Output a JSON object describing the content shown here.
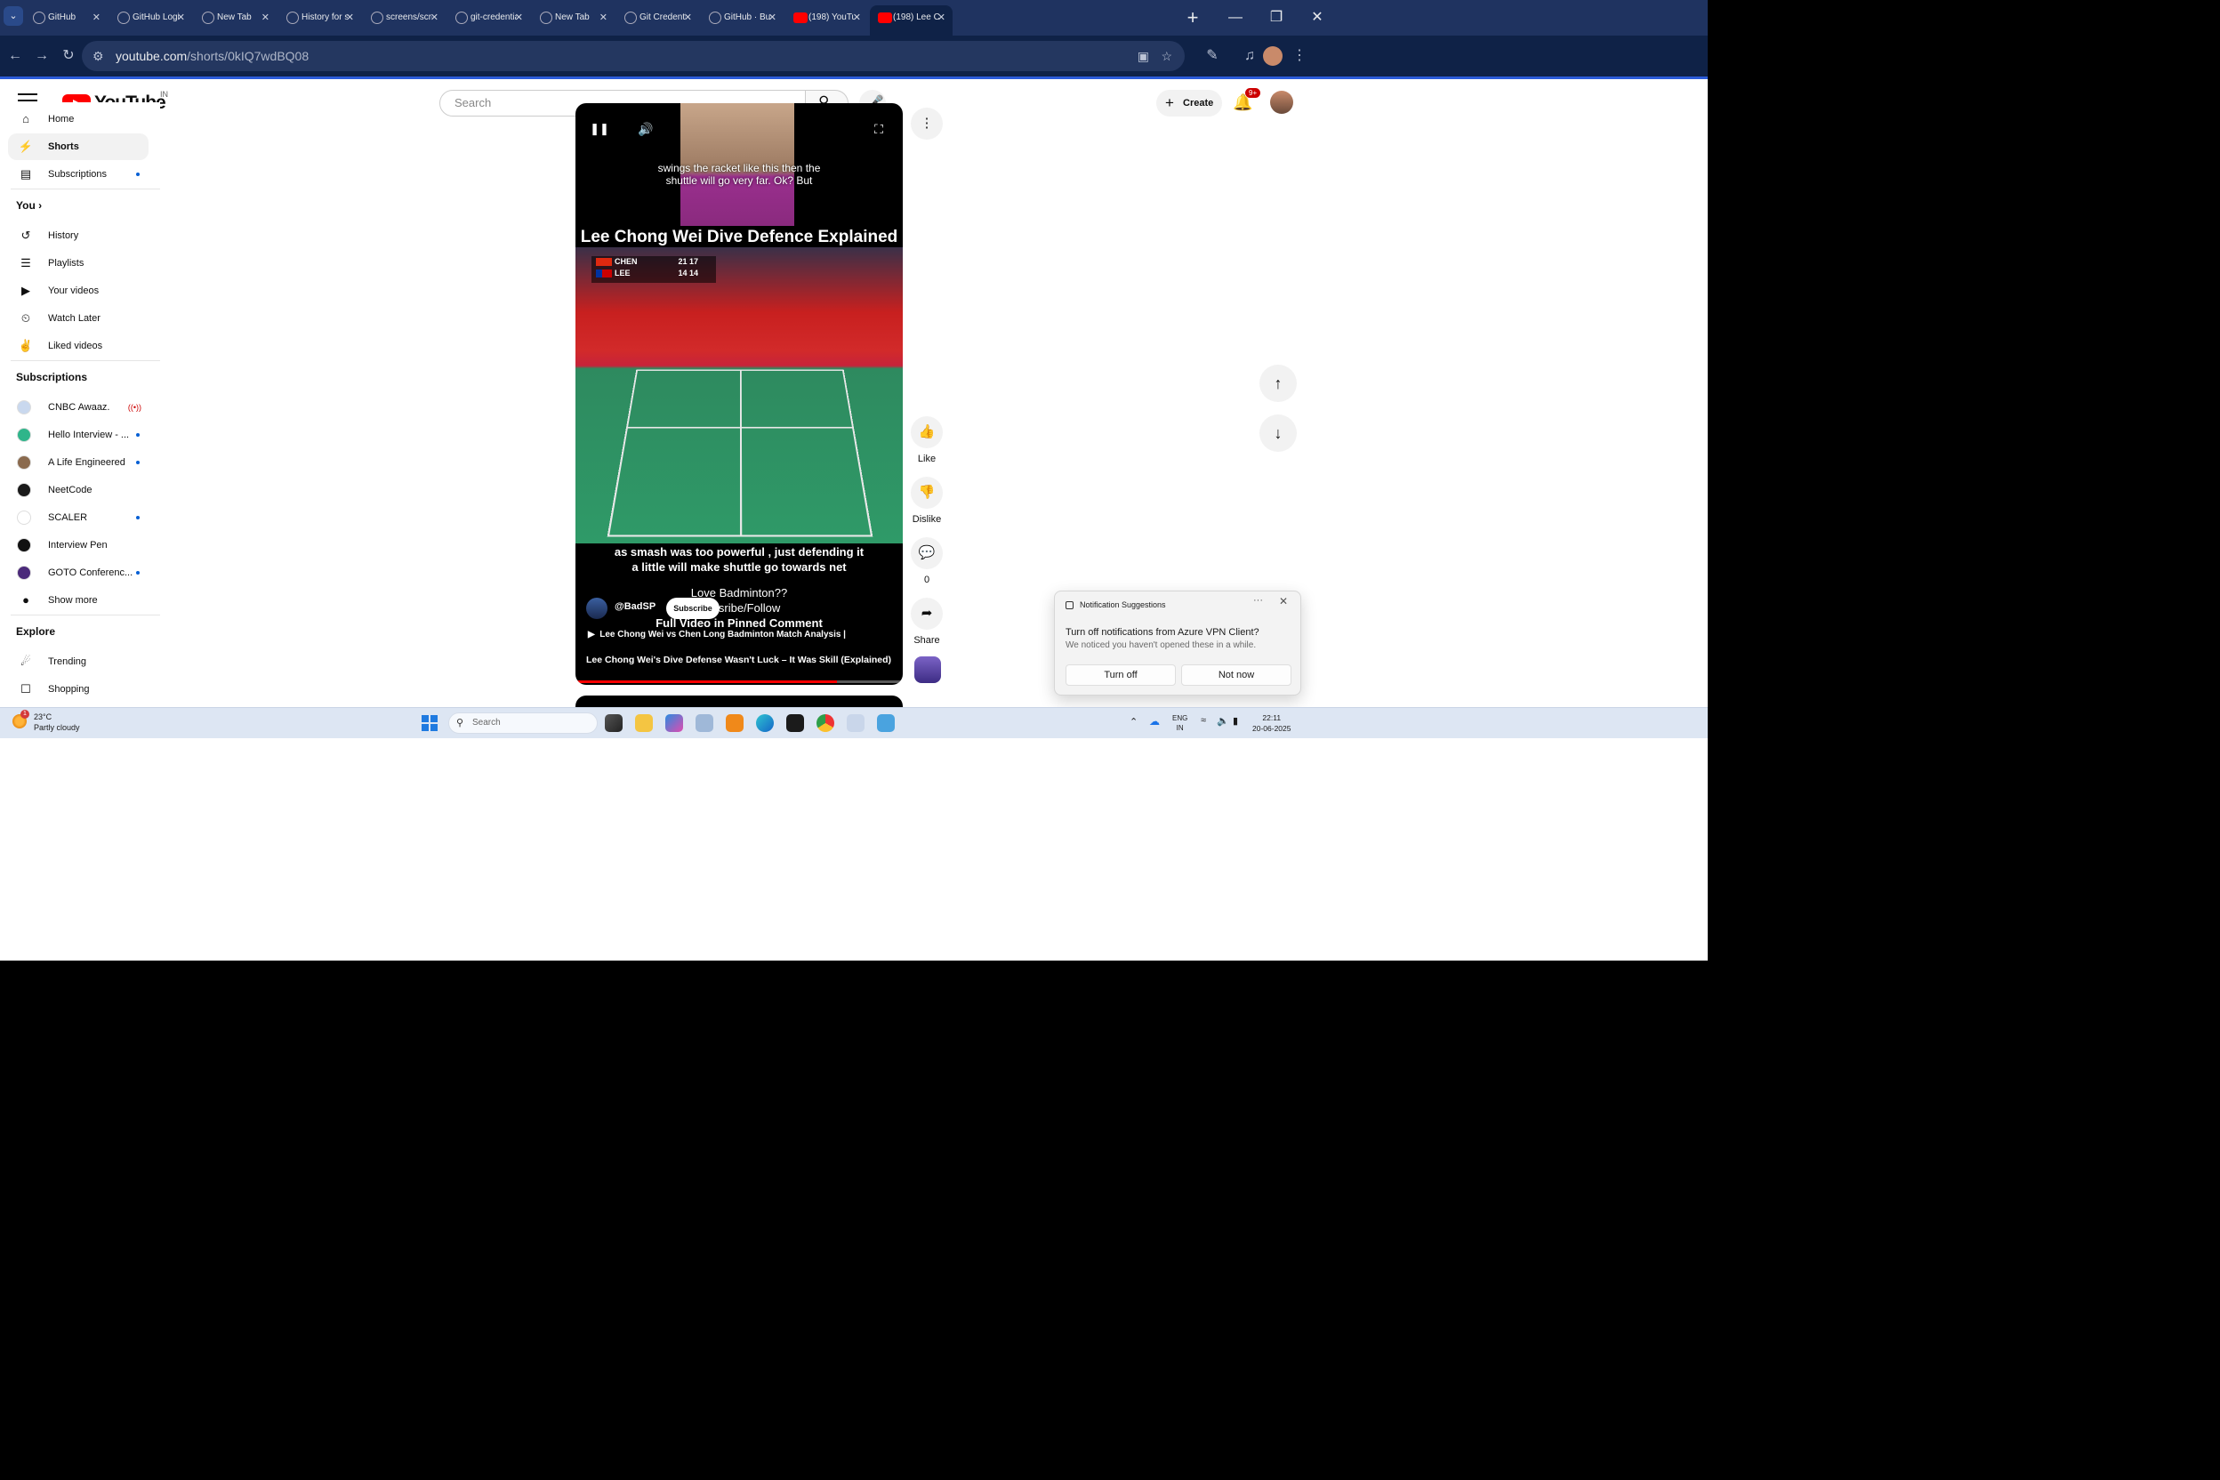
{
  "browser": {
    "tabs": [
      {
        "title": "GitHub",
        "favicon": "github-icon"
      },
      {
        "title": "GitHub Login Is",
        "favicon": "github-icon"
      },
      {
        "title": "New Tab",
        "favicon": "chrome-icon"
      },
      {
        "title": "History for scr",
        "favicon": "github-icon"
      },
      {
        "title": "screens/screen",
        "favicon": "github-icon"
      },
      {
        "title": "git-credential-",
        "favicon": "github-icon"
      },
      {
        "title": "New Tab",
        "favicon": "chrome-icon"
      },
      {
        "title": "Git Credential M",
        "favicon": "chrome-icon"
      },
      {
        "title": "GitHub · Build",
        "favicon": "github-icon"
      },
      {
        "title": "(198) YouTube",
        "favicon": "youtube-icon"
      },
      {
        "title": "(198) Lee C",
        "favicon": "youtube-icon",
        "active": true
      }
    ],
    "new_tab": "+",
    "url_host": "youtube.com",
    "url_path": "/shorts/0kIQ7wdBQ08"
  },
  "header": {
    "logo_text": "YouTube",
    "country": "IN",
    "search_placeholder": "Search",
    "create_label": "Create",
    "notification_count": "9+"
  },
  "sidebar": {
    "main": [
      {
        "label": "Home",
        "icon": "home-icon"
      },
      {
        "label": "Shorts",
        "icon": "shorts-icon",
        "active": true
      },
      {
        "label": "Subscriptions",
        "icon": "subscriptions-icon",
        "dot": true
      }
    ],
    "you_heading": "You",
    "you_items": [
      {
        "label": "History",
        "icon": "history-icon"
      },
      {
        "label": "Playlists",
        "icon": "playlists-icon"
      },
      {
        "label": "Your videos",
        "icon": "your-videos-icon"
      },
      {
        "label": "Watch Later",
        "icon": "clock-icon"
      },
      {
        "label": "Liked videos",
        "icon": "thumbs-up-icon"
      }
    ],
    "subs_heading": "Subscriptions",
    "subscriptions": [
      {
        "label": "CNBC Awaaz.",
        "live": true,
        "color": "#c9d8ee"
      },
      {
        "label": "Hello Interview - ...",
        "dot": true,
        "color": "#2fb58a"
      },
      {
        "label": "A Life Engineered",
        "dot": true,
        "color": "#8a6a4e"
      },
      {
        "label": "NeetCode",
        "dot": false,
        "color": "#1a1a1a"
      },
      {
        "label": "SCALER",
        "dot": true,
        "color": "#ffffff"
      },
      {
        "label": "Interview Pen",
        "dot": false,
        "color": "#111111"
      },
      {
        "label": "GOTO Conferenc...",
        "dot": true,
        "color": "#4b2a7a"
      }
    ],
    "show_more": "Show more",
    "explore_heading": "Explore",
    "explore_items": [
      {
        "label": "Trending",
        "icon": "trending-icon"
      },
      {
        "label": "Shopping",
        "icon": "shopping-icon"
      }
    ]
  },
  "short": {
    "caption_top": "swings the racket like this then the\nshuttle will go very far.  Ok?  But",
    "headline": "Lee Chong Wei Dive Defence Explained",
    "scoreboard": [
      {
        "name": "CHEN",
        "scores": "21 17"
      },
      {
        "name": "LEE",
        "scores": "14 14"
      }
    ],
    "caption_bottom": "as smash was too powerful , just defending it\na little will make shuttle go towards net",
    "promo_line1": "Love Badminton??",
    "promo_line2": "Subsribe/Follow",
    "promo_line3": "Full Video in Pinned Comment",
    "channel_handle": "@BadSP",
    "subscribe_label": "Subscribe",
    "music_title": "Lee Chong Wei vs Chen Long Badminton Match Analysis |",
    "video_title": "Lee Chong Wei's Dive Defense Wasn't Luck – It Was Skill (Explained)",
    "progress": 0.8
  },
  "actions": {
    "like_label": "Like",
    "dislike_label": "Dislike",
    "comments_count": "0",
    "share_label": "Share"
  },
  "notification": {
    "header": "Notification Suggestions",
    "message": "Turn off notifications from Azure VPN Client?",
    "sub": "We noticed you haven't opened these in a while.",
    "turn_off": "Turn off",
    "not_now": "Not now"
  },
  "taskbar": {
    "temperature": "23°C",
    "weather": "Partly cloudy",
    "weather_badge": "1",
    "search_placeholder": "Search",
    "lang": "ENG",
    "region": "IN",
    "time": "22:11",
    "date": "20-06-2025"
  }
}
